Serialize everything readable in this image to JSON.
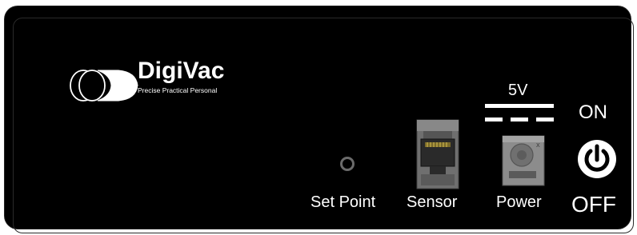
{
  "brand": {
    "name": "DigiVac",
    "tagline": "Precise Practical Personal"
  },
  "labels": {
    "set_point": "Set Point",
    "sensor": "Sensor",
    "power": "Power",
    "voltage": "5V",
    "on": "ON",
    "off": "OFF"
  },
  "colors": {
    "panel": "#000000",
    "text": "#ffffff",
    "jack_gray": "#8c8c8c"
  },
  "icons": {
    "logo": "digivac-ellipse-logo",
    "power": "power-icon",
    "dc": "dc-voltage-symbol"
  }
}
